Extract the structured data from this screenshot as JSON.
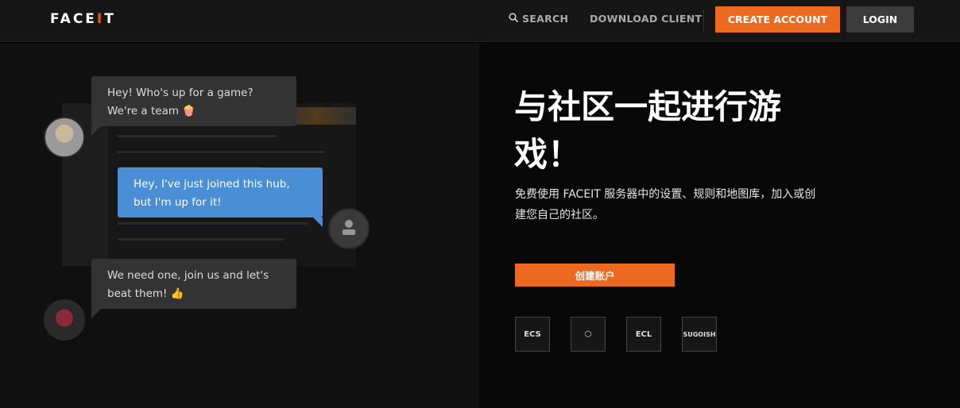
{
  "header": {
    "logo": "FACEIT",
    "search_label": "SEARCH",
    "download_label": "DOWNLOAD CLIENT",
    "create_account_label": "CREATE ACCOUNT",
    "login_label": "LOGIN"
  },
  "chat": {
    "bubbles": [
      {
        "line1": "Hey! Who's up for a game?",
        "line2": "We're a team 🍿"
      },
      {
        "line1": "Hey, I've just joined this hub,",
        "line2": "but I'm up for it!"
      },
      {
        "line1": "We need one, join us and let's",
        "line2": "beat them! 👍"
      }
    ]
  },
  "hero": {
    "headline_line1": "与社区一起进行游",
    "headline_line2": "戏！",
    "description_line1": "免费使用 FACEIT 服务器中的设置、规则和地图库，加入或创",
    "description_line2": "建您自己的社区。",
    "cta_label": "创建账户"
  },
  "partners": [
    {
      "name": "ECS",
      "label": "ECS"
    },
    {
      "name": "hex-logo",
      "label": "⬡"
    },
    {
      "name": "ECL",
      "label": "ECL"
    },
    {
      "name": "SUGOISH",
      "label": "SUGOISH"
    }
  ],
  "colors": {
    "accent": "#ec6a1f",
    "chat_blue": "#4a8fd6",
    "header_bg": "#161616"
  }
}
